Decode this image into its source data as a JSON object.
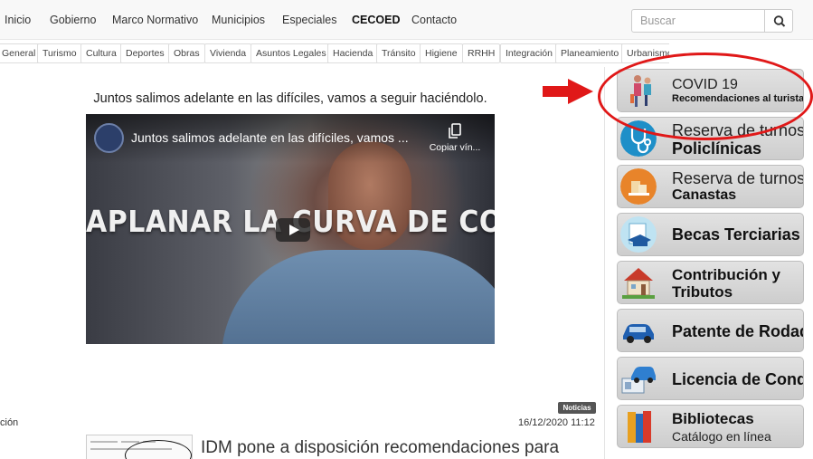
{
  "nav": {
    "items": [
      "Inicio",
      "Gobierno",
      "Marco Normativo",
      "Municipios",
      "Especiales",
      "CECOED",
      "Contacto"
    ],
    "search_placeholder": "Buscar"
  },
  "categories": [
    "General",
    "Turismo",
    "Cultura",
    "Deportes",
    "Obras",
    "Vivienda",
    "Asuntos Legales",
    "Hacienda",
    "Tránsito",
    "Higiene",
    "RRHH",
    "Integración",
    "Planeamiento",
    "Urbanismo"
  ],
  "main": {
    "caption": "Juntos salimos adelante en las difíciles, vamos a seguir haciéndolo.",
    "video": {
      "title": "Juntos salimos adelante en las difíciles, vamos ...",
      "copy_label": "Copiar vín...",
      "overlay_text": "APLANAR LA CURVA DE CONTAGIOS"
    },
    "post": {
      "badge": "Noticias",
      "category_fragment": "ción",
      "date": "16/12/2020 11:12",
      "title": "IDM pone a disposición recomendaciones para"
    }
  },
  "sidebar": {
    "covid_title": "COVID 19",
    "covid_sub": "Recomendaciones al turista",
    "policlinicas_line1": "Reserva de turnos",
    "policlinicas_line2": "Policlínicas",
    "canastas_line1": "Reserva de turnos",
    "canastas_line2": "Canastas",
    "becas": "Becas Terciarias",
    "contribucion_line1": "Contribución y",
    "contribucion_line2": "Tributos",
    "patente": "Patente de Rodados",
    "licencia": "Licencia de Conducir",
    "bibliotecas_line1": "Bibliotecas",
    "bibliotecas_line2": "Catálogo en línea"
  },
  "colors": {
    "annotation": "#e01818",
    "nav_bg": "#f8f8f8",
    "button_gray": "#d6d6d6"
  }
}
